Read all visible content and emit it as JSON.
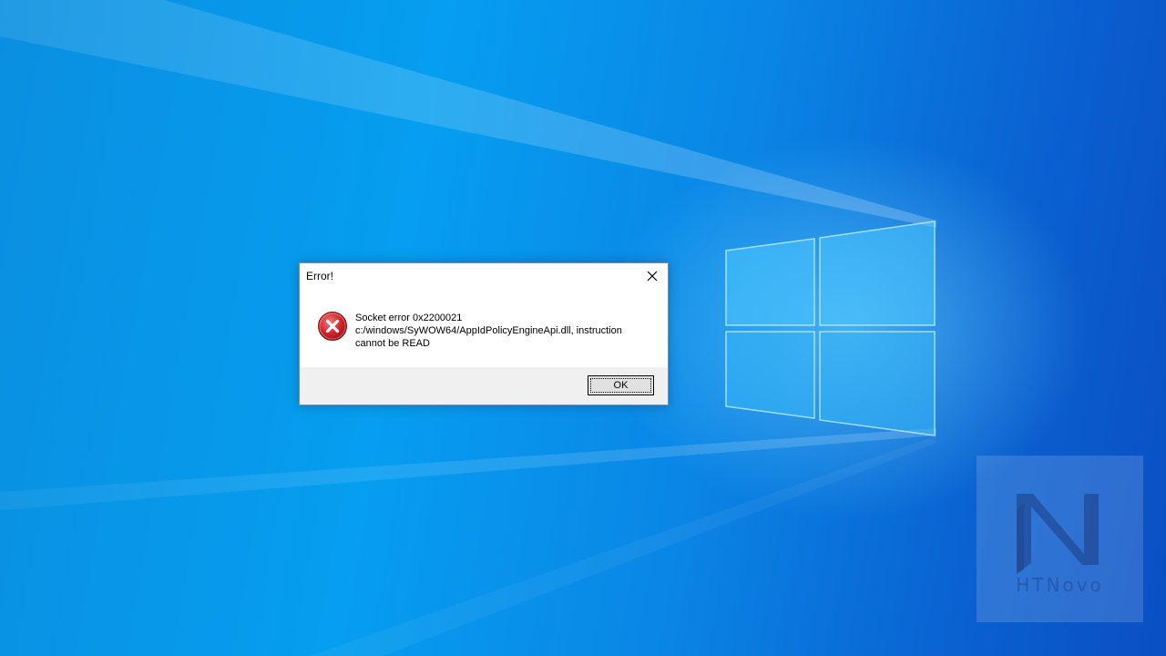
{
  "dialog": {
    "title": "Error!",
    "message_lines": [
      "Socket error 0x2200021",
      "c:/windows/SyWOW64/AppIdPolicyEngineApi.dll, instruction",
      "cannot be READ"
    ],
    "ok_label": "OK",
    "icon": "error-icon"
  },
  "watermark": {
    "text": "HTNovo",
    "logo": "N"
  },
  "colors": {
    "desktop_blue": "#069ef0",
    "error_red": "#c8262b",
    "dialog_footer": "#f0f0f0"
  }
}
